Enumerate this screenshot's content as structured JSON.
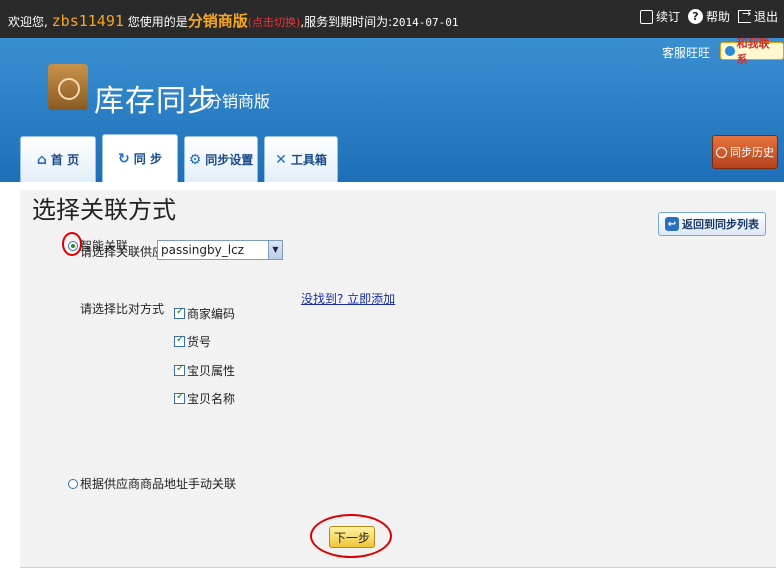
{
  "topbar": {
    "welcome_prefix": "欢迎您,",
    "username": "zbs11491",
    "using_text": "您使用的是",
    "edition": "分销商版",
    "switch": "(点击切换)",
    "service_prefix": ",服务到期时间为:",
    "expire_date": "2014-07-01",
    "links": {
      "order": "续订",
      "help": "帮助",
      "logout": "退出"
    }
  },
  "header": {
    "logo_title": "库存同步",
    "logo_subtitle": "分销商版",
    "service_label": "客服旺旺",
    "contact_label": "和我联系",
    "history_button": "同步历史"
  },
  "tabs": [
    {
      "label": "首 页",
      "icon": "home-icon"
    },
    {
      "label": "同 步",
      "icon": "refresh-icon"
    },
    {
      "label": "同步设置",
      "icon": "gear-icon"
    },
    {
      "label": "工具箱",
      "icon": "wrench-icon"
    }
  ],
  "main": {
    "title": "选择关联方式",
    "back_button": "返回到同步列表",
    "smart_label": "智能关联",
    "supplier_prompt": "请选择关联供应商",
    "supplier_value": "passingby_lcz",
    "add_link": "没找到? 立即添加",
    "compare_prompt": "请选择比对方式",
    "compare_options": [
      {
        "label": "商家编码",
        "checked": true
      },
      {
        "label": "货号",
        "checked": true
      },
      {
        "label": "宝贝属性",
        "checked": true
      },
      {
        "label": "宝贝名称",
        "checked": true
      }
    ],
    "manual_label": "根据供应商商品地址手动关联",
    "next_button": "下一步"
  }
}
